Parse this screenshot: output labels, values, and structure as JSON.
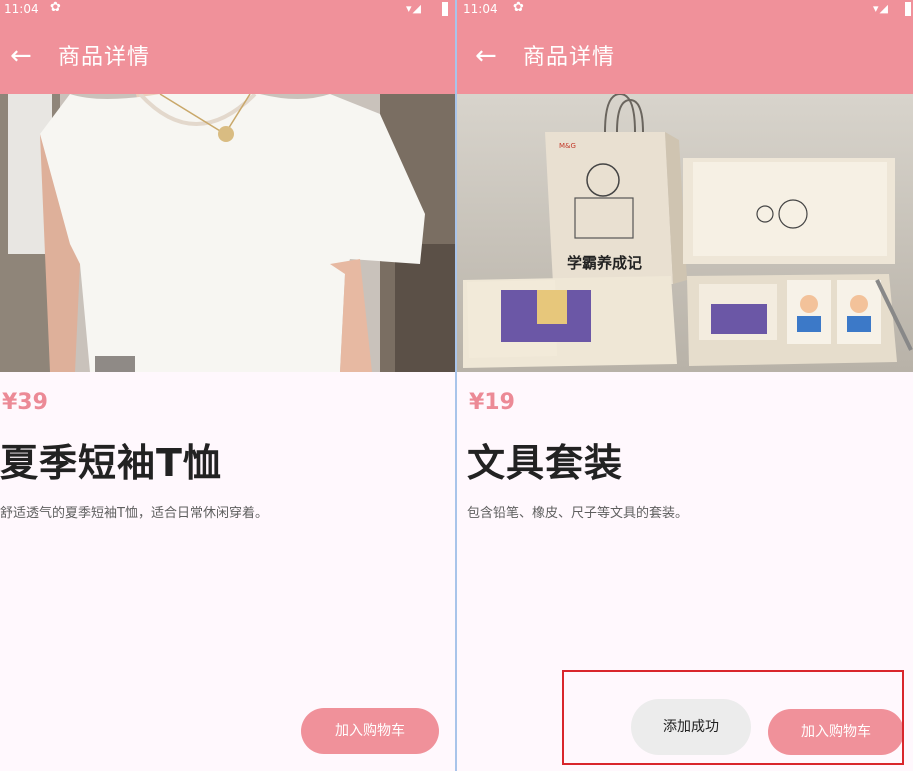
{
  "left": {
    "status_time": "11:04",
    "title": "商品详情",
    "price": "¥39",
    "name": "夏季短袖T恤",
    "description": "舒适透气的夏季短袖T恤，适合日常休闲穿着。",
    "cart_button": "加入购物车"
  },
  "right": {
    "status_time": "11:04",
    "title": "商品详情",
    "price": "¥19",
    "name": "文具套装",
    "description": "包含铅笔、橡皮、尺子等文具的套装。",
    "cart_button": "加入购物车",
    "toast": "添加成功",
    "box_logo": "M&G",
    "box_text": "学霸养成记"
  },
  "colors": {
    "accent": "#f0919a",
    "price": "#ec8a96",
    "highlight": "#d9262c"
  },
  "icons": {
    "back": "arrow-left-icon",
    "settings": "gear-icon",
    "wifi": "wifi-icon",
    "signal": "signal-icon",
    "battery": "battery-icon"
  }
}
